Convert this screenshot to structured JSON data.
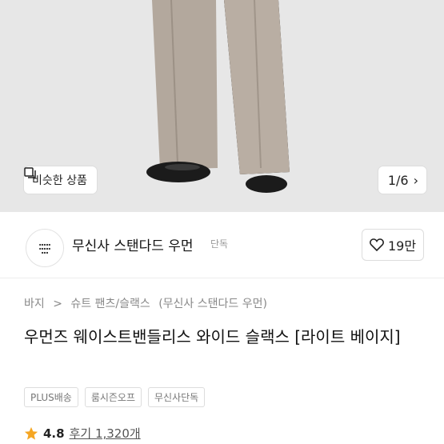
{
  "image": {
    "similar_label": "비슷한 상품",
    "counter": "1/6"
  },
  "brand": {
    "name": "무신사 스탠다드 우먼",
    "tag": "단독",
    "likes": "19만"
  },
  "breadcrumb": [
    "바지",
    "슈트 팬츠/슬랙스",
    "(무신사 스탠다드 우먼)"
  ],
  "product": {
    "title": "우먼즈 웨이스트밴들리스 와이드 슬랙스 [라이트 베이지]",
    "chips": [
      "PLUS배송",
      "룸시즌오프",
      "무신사단독"
    ],
    "rating": "4.8",
    "review_label": "후기 1,320개"
  },
  "colors": {
    "pants": "#b3a89d",
    "background": "#e7e7e7",
    "star": "#f5a623"
  }
}
